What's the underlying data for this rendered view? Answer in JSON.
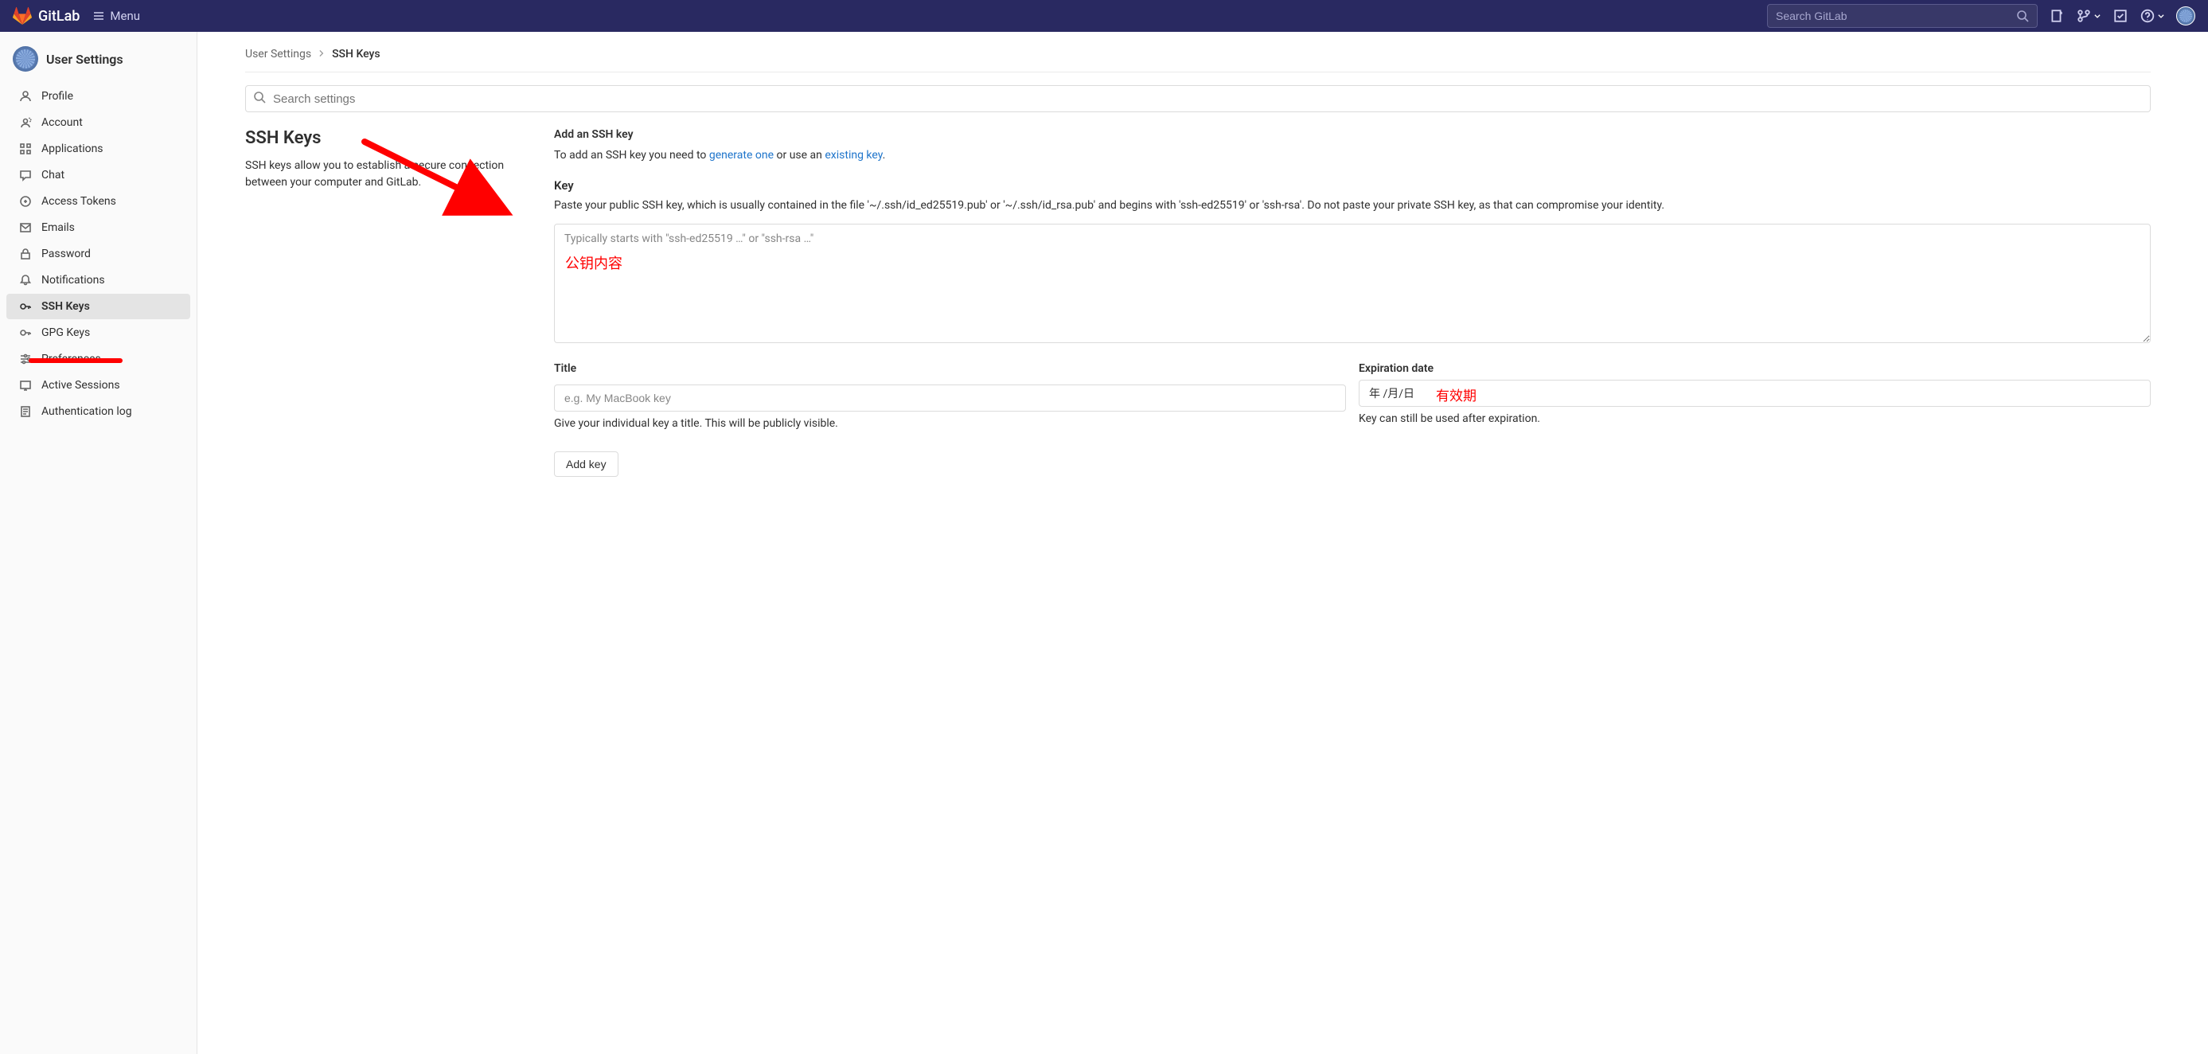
{
  "navbar": {
    "brand": "GitLab",
    "menu_label": "Menu",
    "search_placeholder": "Search GitLab"
  },
  "sidebar": {
    "title": "User Settings",
    "items": [
      {
        "label": "Profile",
        "icon": "user"
      },
      {
        "label": "Account",
        "icon": "account"
      },
      {
        "label": "Applications",
        "icon": "apps"
      },
      {
        "label": "Chat",
        "icon": "chat"
      },
      {
        "label": "Access Tokens",
        "icon": "token"
      },
      {
        "label": "Emails",
        "icon": "mail"
      },
      {
        "label": "Password",
        "icon": "lock"
      },
      {
        "label": "Notifications",
        "icon": "bell"
      },
      {
        "label": "SSH Keys",
        "icon": "key"
      },
      {
        "label": "GPG Keys",
        "icon": "key"
      },
      {
        "label": "Preferences",
        "icon": "prefs"
      },
      {
        "label": "Active Sessions",
        "icon": "sessions"
      },
      {
        "label": "Authentication log",
        "icon": "log"
      }
    ]
  },
  "breadcrumb": {
    "root": "User Settings",
    "current": "SSH Keys"
  },
  "search_settings": {
    "placeholder": "Search settings"
  },
  "section": {
    "heading": "SSH Keys",
    "description": "SSH keys allow you to establish a secure connection between your computer and GitLab."
  },
  "form": {
    "title": "Add an SSH key",
    "intro_1": "To add an SSH key you need to ",
    "intro_link1": "generate one",
    "intro_2": " or use an ",
    "intro_link2": "existing key",
    "intro_3": ".",
    "key_label": "Key",
    "key_help": "Paste your public SSH key, which is usually contained in the file '~/.ssh/id_ed25519.pub' or '~/.ssh/id_rsa.pub' and begins with 'ssh-ed25519' or 'ssh-rsa'. Do not paste your private SSH key, as that can compromise your identity.",
    "key_placeholder": "Typically starts with \"ssh-ed25519 …\" or \"ssh-rsa …\"",
    "title_label": "Title",
    "title_placeholder": "e.g. My MacBook key",
    "title_hint": "Give your individual key a title. This will be publicly visible.",
    "expiration_label": "Expiration date",
    "expiration_placeholder": "年 /月/日",
    "expiration_hint": "Key can still be used after expiration.",
    "submit_label": "Add key"
  },
  "annotations": {
    "key_content": "公钥内容",
    "validity": "有效期"
  }
}
